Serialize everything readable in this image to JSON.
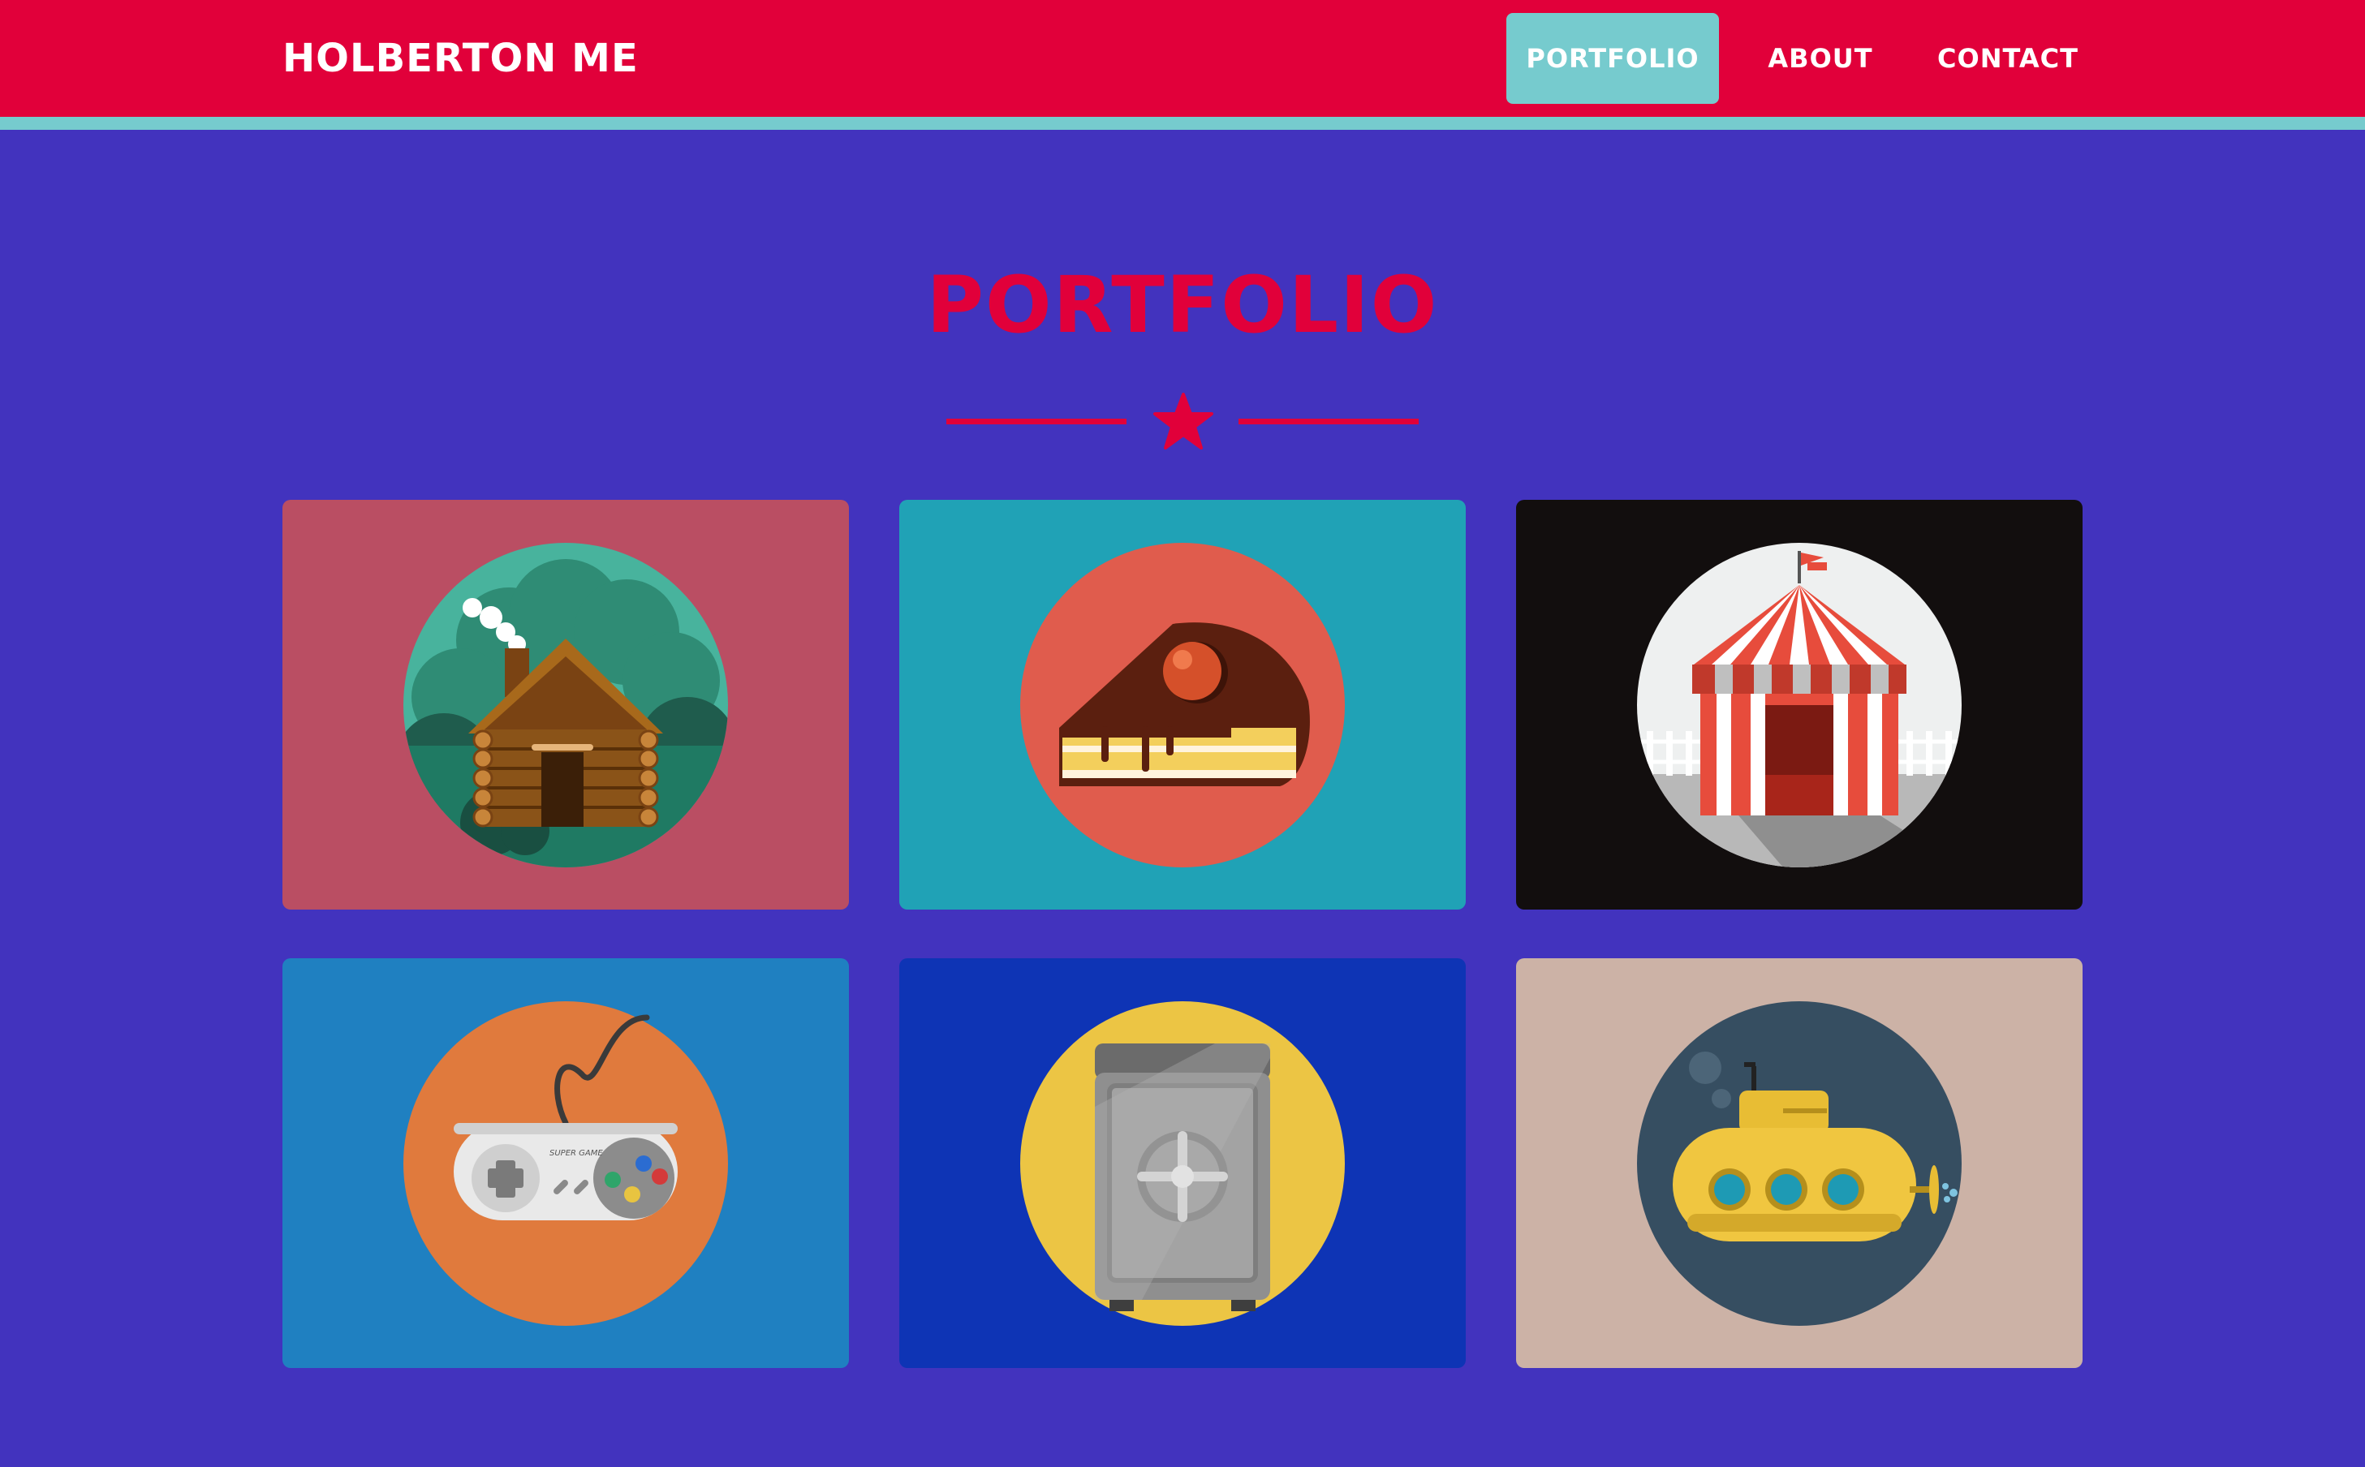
{
  "navbar": {
    "brand": "HOLBERTON ME",
    "links": [
      {
        "label": "PORTFOLIO",
        "active": true
      },
      {
        "label": "ABOUT",
        "active": false
      },
      {
        "label": "CONTACT",
        "active": false
      }
    ]
  },
  "portfolio": {
    "title": "PORTFOLIO",
    "items": [
      {
        "icon": "log-cabin-icon",
        "background": "#ba4e63"
      },
      {
        "icon": "cake-slice-icon",
        "background": "#20a2b6"
      },
      {
        "icon": "circus-tent-icon",
        "background": "#120e0e"
      },
      {
        "icon": "game-controller-icon",
        "background": "#1f80c1"
      },
      {
        "icon": "safe-icon",
        "background": "#0e34b5"
      },
      {
        "icon": "submarine-icon",
        "background": "#ccb2a6"
      }
    ],
    "controller_label": "SUPER GAME"
  },
  "colors": {
    "navbar": "#e1003a",
    "navbar_border": "#76cbce",
    "active_link": "#76cbce",
    "page_background": "#4233be",
    "accent": "#e1003a"
  }
}
